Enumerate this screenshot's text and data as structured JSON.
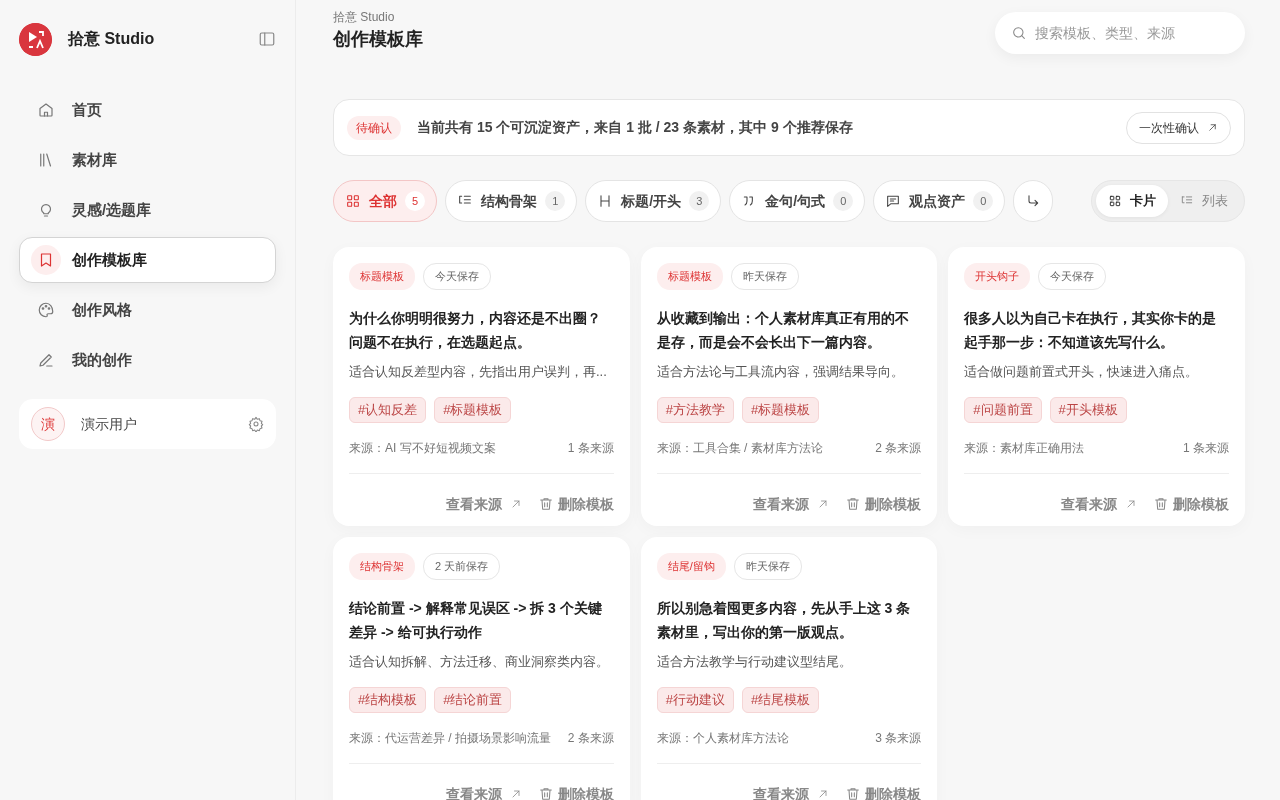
{
  "sidebar": {
    "brand": "拾意 Studio",
    "nav": [
      {
        "label": "首页",
        "kind": "home",
        "selected": false
      },
      {
        "label": "素材库",
        "kind": "library",
        "selected": false
      },
      {
        "label": "灵感/选题库",
        "kind": "bulb",
        "selected": false
      },
      {
        "label": "创作模板库",
        "kind": "bookmark",
        "selected": true
      },
      {
        "label": "创作风格",
        "kind": "palette",
        "selected": false
      },
      {
        "label": "我的创作",
        "kind": "pen",
        "selected": false
      }
    ],
    "user": {
      "avatar": "演",
      "name": "演示用户"
    }
  },
  "header": {
    "breadcrumb": "拾意 Studio",
    "title": "创作模板库",
    "search": {
      "placeholder": "搜索模板、类型、来源"
    }
  },
  "banner": {
    "badge": "待确认",
    "text": "当前共有 15 个可沉淀资产，来自 1 批 / 23 条素材，其中 9 个推荐保存",
    "button": "一次性确认"
  },
  "filters": [
    {
      "label": "全部",
      "count": "5",
      "kind": "grid",
      "selected": true
    },
    {
      "label": "结构骨架",
      "count": "1",
      "kind": "list",
      "selected": false
    },
    {
      "label": "标题/开头",
      "count": "3",
      "kind": "heading",
      "selected": false
    },
    {
      "label": "金句/句式",
      "count": "0",
      "kind": "quote",
      "selected": false
    },
    {
      "label": "观点资产",
      "count": "0",
      "kind": "comment",
      "selected": false
    },
    {
      "kind": "turn",
      "selected": false
    }
  ],
  "view_toggle": [
    {
      "label": "卡片",
      "kind": "grid",
      "selected": true
    },
    {
      "label": "列表",
      "kind": "list",
      "selected": false
    }
  ],
  "cards": [
    {
      "type": "标题模板",
      "saved": "今天保存",
      "title": "为什么你明明很努力，内容还是不出圈？问题不在执行，在选题起点。",
      "desc": "适合认知反差型内容，先指出用户误判，再...",
      "tags": [
        "#认知反差",
        "#标题模板"
      ],
      "source": "来源：AI 写不好短视频文案",
      "source_count": "1 条来源",
      "view": "查看来源",
      "delete": "删除模板"
    },
    {
      "type": "标题模板",
      "saved": "昨天保存",
      "title": "从收藏到输出：个人素材库真正有用的不是存，而是会不会长出下一篇内容。",
      "desc": "适合方法论与工具流内容，强调结果导向。",
      "tags": [
        "#方法教学",
        "#标题模板"
      ],
      "source": "来源：工具合集 / 素材库方法论",
      "source_count": "2 条来源",
      "view": "查看来源",
      "delete": "删除模板"
    },
    {
      "type": "开头钩子",
      "saved": "今天保存",
      "title": "很多人以为自己卡在执行，其实你卡的是起手那一步：不知道该先写什么。",
      "desc": "适合做问题前置式开头，快速进入痛点。",
      "tags": [
        "#问题前置",
        "#开头模板"
      ],
      "source": "来源：素材库正确用法",
      "source_count": "1 条来源",
      "view": "查看来源",
      "delete": "删除模板"
    },
    {
      "type": "结构骨架",
      "saved": "2 天前保存",
      "title": "结论前置 -> 解释常见误区 -> 拆 3 个关键差异 -> 给可执行动作",
      "desc": "适合认知拆解、方法迁移、商业洞察类内容。",
      "tags": [
        "#结构模板",
        "#结论前置"
      ],
      "source": "来源：代运营差异 / 拍摄场景影响流量",
      "source_count": "2 条来源",
      "view": "查看来源",
      "delete": "删除模板"
    },
    {
      "type": "结尾/留钩",
      "saved": "昨天保存",
      "title": "所以别急着囤更多内容，先从手上这 3 条素材里，写出你的第一版观点。",
      "desc": "适合方法教学与行动建议型结尾。",
      "tags": [
        "#行动建议",
        "#结尾模板"
      ],
      "source": "来源：个人素材库方法论",
      "source_count": "3 条来源",
      "view": "查看来源",
      "delete": "删除模板"
    }
  ]
}
